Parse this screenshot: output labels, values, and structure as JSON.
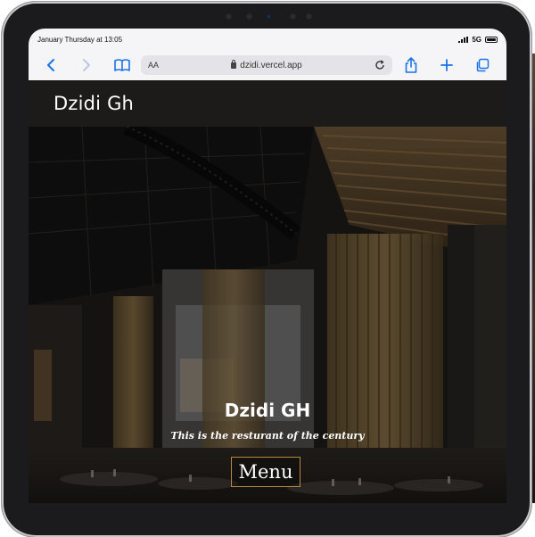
{
  "status_bar": {
    "datetime": "January Thursday at 13:05",
    "network": "5G"
  },
  "browser": {
    "text_size_label": "AA",
    "url": "dzidi.vercel.app",
    "icons": [
      "back-icon",
      "forward-icon",
      "bookmarks-icon",
      "lock-icon",
      "reload-icon",
      "share-icon",
      "new-tab-icon",
      "tabs-icon"
    ]
  },
  "site": {
    "brand": "Dzidi Gh",
    "hero": {
      "title": "Dzidi GH",
      "subtitle": "This is the resturant of the century",
      "menu_button": "Menu"
    }
  },
  "colors": {
    "accent": "#1a73e8",
    "button_border": "#b8893b",
    "header_bg": "#1c1b1a"
  }
}
